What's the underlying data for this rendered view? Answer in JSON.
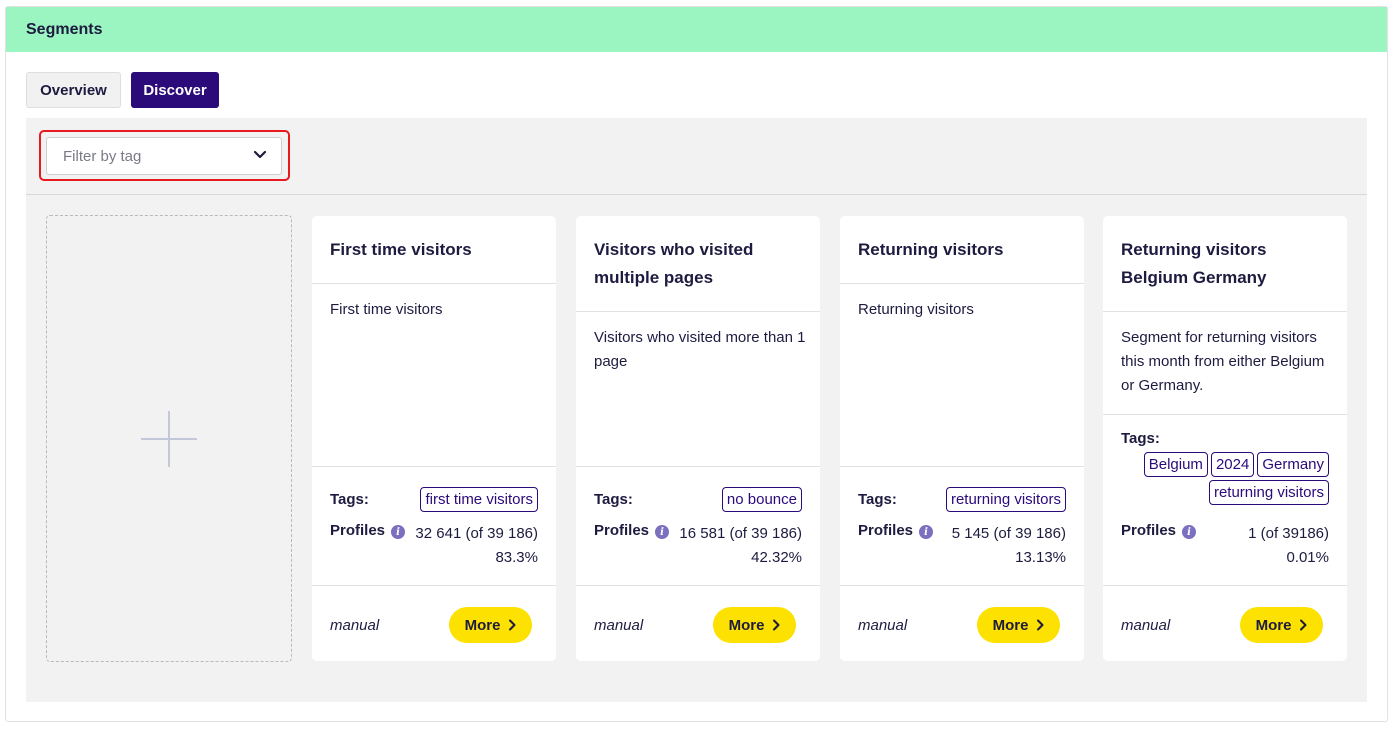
{
  "panel": {
    "title": "Segments"
  },
  "tabs": [
    {
      "label": "Overview"
    },
    {
      "label": "Discover"
    }
  ],
  "filter": {
    "placeholder": "Filter by tag"
  },
  "labels": {
    "tags": "Tags:",
    "profiles": "Profiles",
    "more": "More"
  },
  "cards": [
    {
      "title": "First time visitors",
      "description": "First time visitors",
      "tags": [
        "first time visitors"
      ],
      "profiles_count": "32 641 (of 39 186)",
      "profiles_percent": "83.3%",
      "type": "manual"
    },
    {
      "title": "Visitors who visited multiple pages",
      "description": "Visitors who visited more than 1 page",
      "tags": [
        "no bounce"
      ],
      "profiles_count": "16 581 (of 39 186)",
      "profiles_percent": "42.32%",
      "type": "manual"
    },
    {
      "title": "Returning visitors",
      "description": "Returning visitors",
      "tags": [
        "returning visitors"
      ],
      "profiles_count": "5 145 (of 39 186)",
      "profiles_percent": "13.13%",
      "type": "manual"
    },
    {
      "title": "Returning visitors Belgium Germany",
      "description": "Segment for returning visitors this month from either Belgium or Germany.",
      "tags": [
        "Belgium",
        "2024",
        "Germany",
        "returning visitors"
      ],
      "profiles_count": "1 (of 39186)",
      "profiles_percent": "0.01%",
      "type": "manual"
    }
  ]
}
